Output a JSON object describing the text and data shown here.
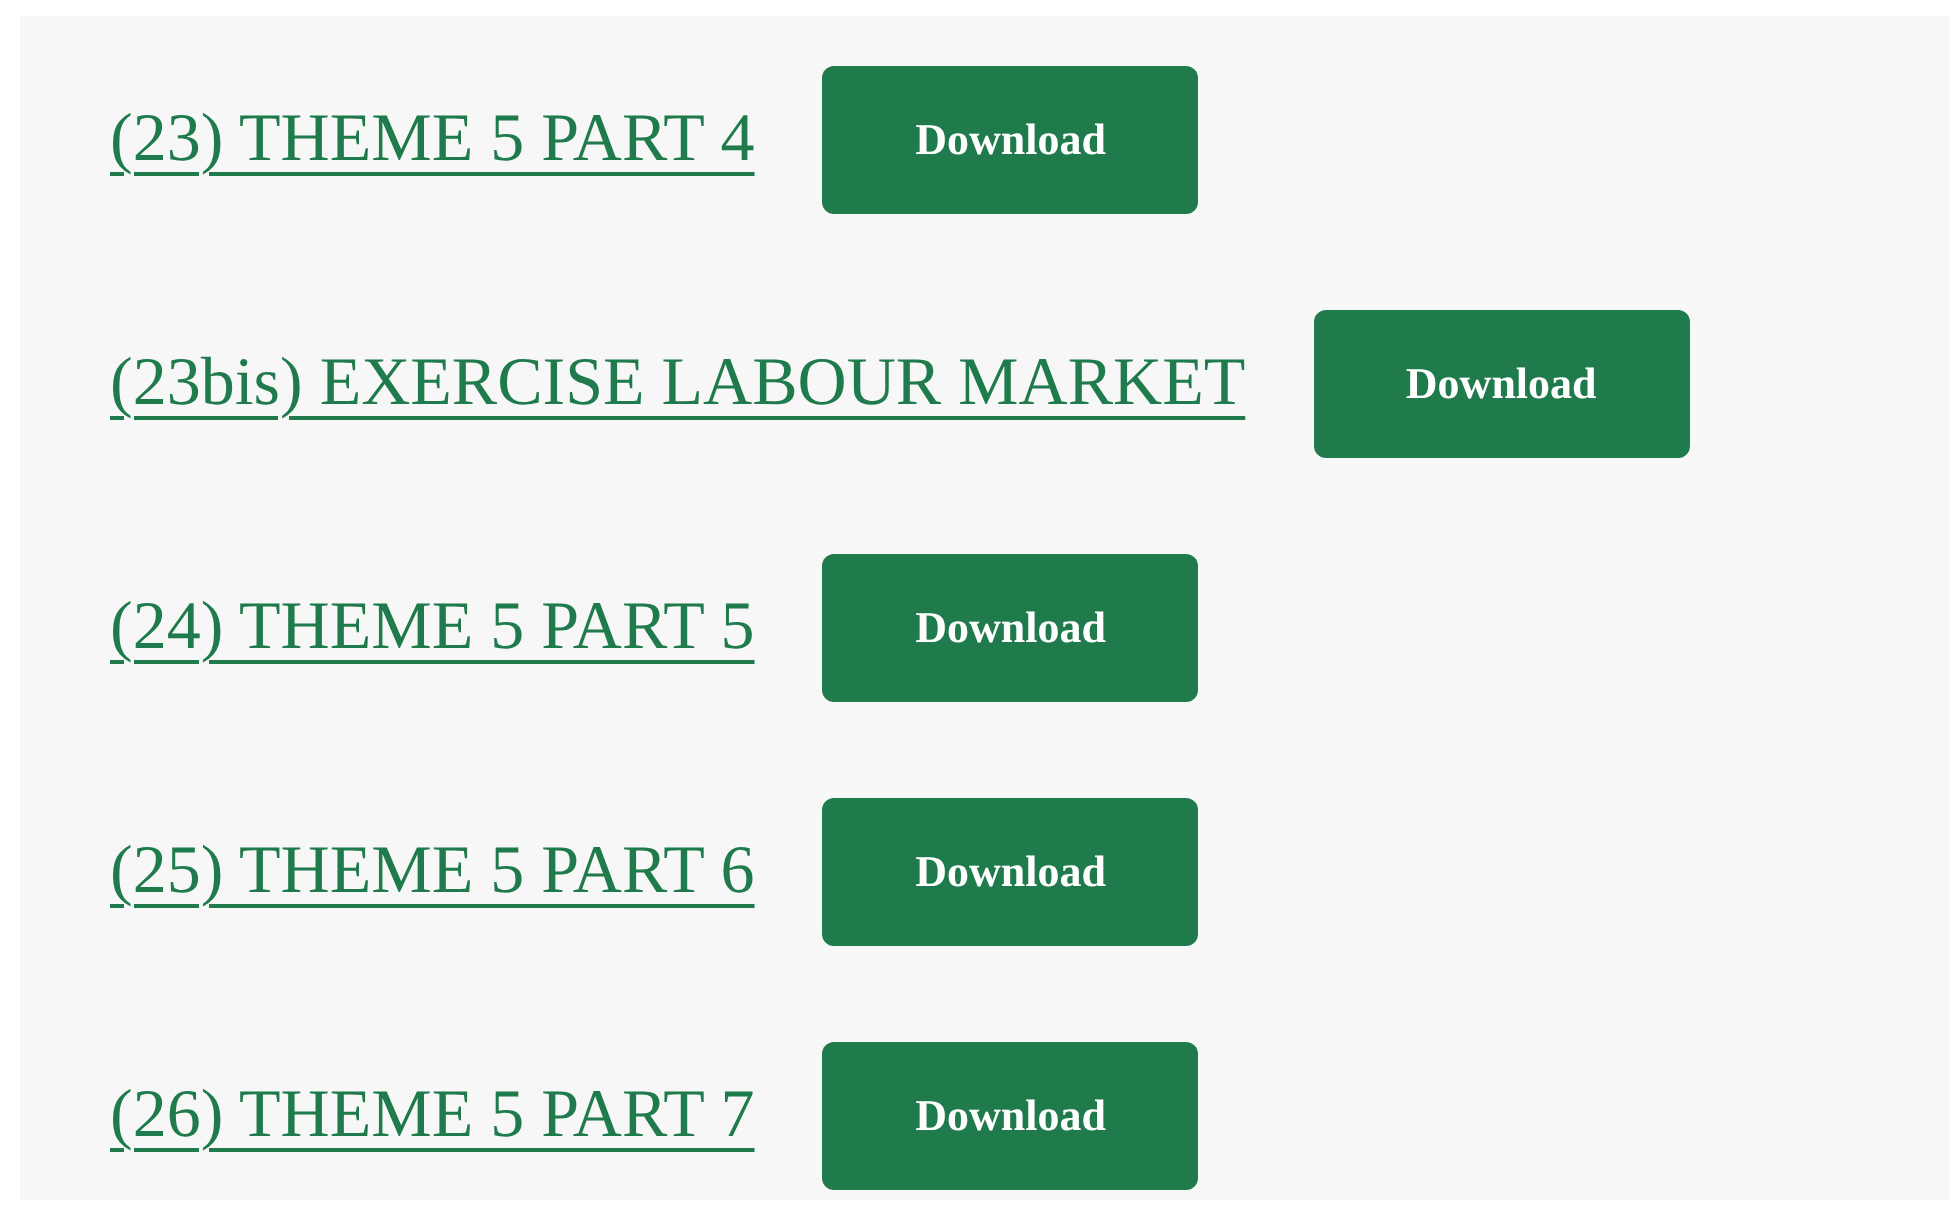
{
  "downloads": [
    {
      "title": "(23) THEME 5 PART 4",
      "button": "Download"
    },
    {
      "title": "(23bis) EXERCISE LABOUR MARKET",
      "button": "Download"
    },
    {
      "title": "(24) THEME 5 PART 5",
      "button": "Download"
    },
    {
      "title": "(25) THEME 5 PART 6",
      "button": "Download"
    },
    {
      "title": "(26) THEME 5 PART 7",
      "button": "Download"
    }
  ]
}
